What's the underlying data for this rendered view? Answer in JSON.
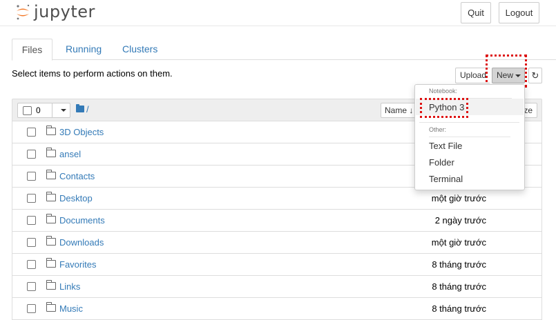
{
  "header": {
    "logo_text": "jupyter",
    "quit_label": "Quit",
    "logout_label": "Logout"
  },
  "tabs": [
    {
      "label": "Files",
      "active": true
    },
    {
      "label": "Running",
      "active": false
    },
    {
      "label": "Clusters",
      "active": false
    }
  ],
  "toolbar": {
    "select_info": "Select items to perform actions on them.",
    "upload_label": "Upload",
    "new_label": "New"
  },
  "list_header": {
    "selected_count": "0",
    "path": "/",
    "name_sort_label": "Name",
    "size_sort_label": "ze"
  },
  "new_menu": {
    "notebook_header": "Notebook:",
    "python_label": "Python 3",
    "other_header": "Other:",
    "items": [
      "Text File",
      "Folder",
      "Terminal"
    ]
  },
  "files": [
    {
      "name": "3D Objects",
      "modified": ""
    },
    {
      "name": "ansel",
      "modified": ""
    },
    {
      "name": "Contacts",
      "modified": ""
    },
    {
      "name": "Desktop",
      "modified": "một giờ trước"
    },
    {
      "name": "Documents",
      "modified": "2 ngày trước"
    },
    {
      "name": "Downloads",
      "modified": "một giờ trước"
    },
    {
      "name": "Favorites",
      "modified": "8 tháng trước"
    },
    {
      "name": "Links",
      "modified": "8 tháng trước"
    },
    {
      "name": "Music",
      "modified": "8 tháng trước"
    }
  ],
  "colors": {
    "link": "#337ab7",
    "highlight": "#dd1111",
    "logo_orange": "#f37726"
  }
}
